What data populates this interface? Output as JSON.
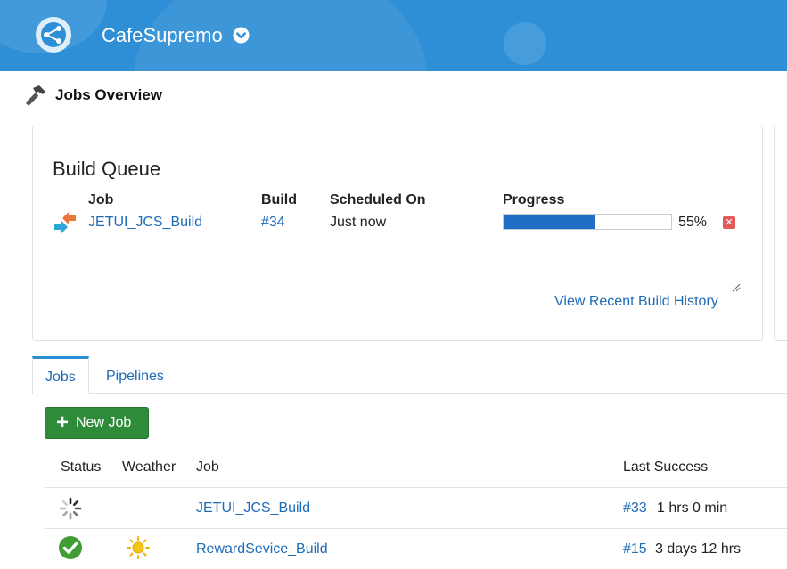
{
  "header": {
    "title": "CafeSupremo"
  },
  "page": {
    "title": "Jobs Overview"
  },
  "queue": {
    "title": "Build Queue",
    "columns": {
      "job": "Job",
      "build": "Build",
      "scheduled": "Scheduled On",
      "progress": "Progress"
    },
    "item": {
      "job": "JETUI_JCS_Build",
      "build": "#34",
      "scheduled": "Just now",
      "progress_pct": "55%",
      "progress_fraction": 0.55
    },
    "history_link": "View Recent Build History"
  },
  "tabs": {
    "jobs": "Jobs",
    "pipelines": "Pipelines"
  },
  "toolbar": {
    "new_job": "New Job"
  },
  "table": {
    "headers": {
      "status": "Status",
      "weather": "Weather",
      "job": "Job",
      "last_success": "Last Success"
    },
    "rows": [
      {
        "status": "building-spinner-icon",
        "weather": "",
        "job": "JETUI_JCS_Build",
        "build": "#33",
        "time": "1 hrs 0 min"
      },
      {
        "status": "success-check-icon",
        "weather": "sunny-icon",
        "job": "RewardSevice_Build",
        "build": "#15",
        "time": "3 days 12 hrs"
      }
    ]
  },
  "colors": {
    "header": "#2e8fd6",
    "link": "#1e6bb8",
    "progress": "#1f6fc6",
    "success": "#2e8b3a"
  }
}
